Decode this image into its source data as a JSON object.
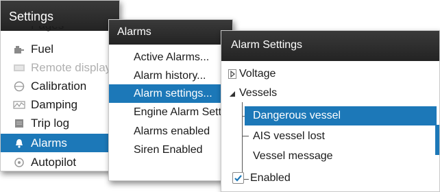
{
  "settings": {
    "title": "Settings",
    "partial_top": "Pages",
    "items": [
      {
        "label": "Fuel",
        "icon": "fuel-icon",
        "dim": false
      },
      {
        "label": "Remote display",
        "icon": "remote-display-icon",
        "dim": true
      },
      {
        "label": "Calibration",
        "icon": "calibration-icon",
        "dim": false
      },
      {
        "label": "Damping",
        "icon": "damping-icon",
        "dim": false
      },
      {
        "label": "Trip log",
        "icon": "trip-log-icon",
        "dim": false
      },
      {
        "label": "Alarms",
        "icon": "bell-icon",
        "dim": false,
        "selected": true
      },
      {
        "label": "Autopilot",
        "icon": "autopilot-icon",
        "dim": false
      }
    ]
  },
  "alarms": {
    "title": "Alarms",
    "items": [
      {
        "label": "Active Alarms..."
      },
      {
        "label": "Alarm history..."
      },
      {
        "label": "Alarm settings...",
        "selected": true
      },
      {
        "label": "Engine Alarm Settings"
      },
      {
        "label": "Alarms enabled"
      },
      {
        "label": "Siren Enabled"
      }
    ]
  },
  "alarm_settings": {
    "title": "Alarm Settings",
    "tree": {
      "voltage": "Voltage",
      "vessels": "Vessels",
      "children": [
        "Dangerous vessel",
        "AIS vessel lost",
        "Vessel message"
      ]
    },
    "enabled_label": "Enabled",
    "enabled_checked": true
  },
  "colors": {
    "selection": "#1c78b8",
    "titlebar": "#2a2a2a"
  }
}
